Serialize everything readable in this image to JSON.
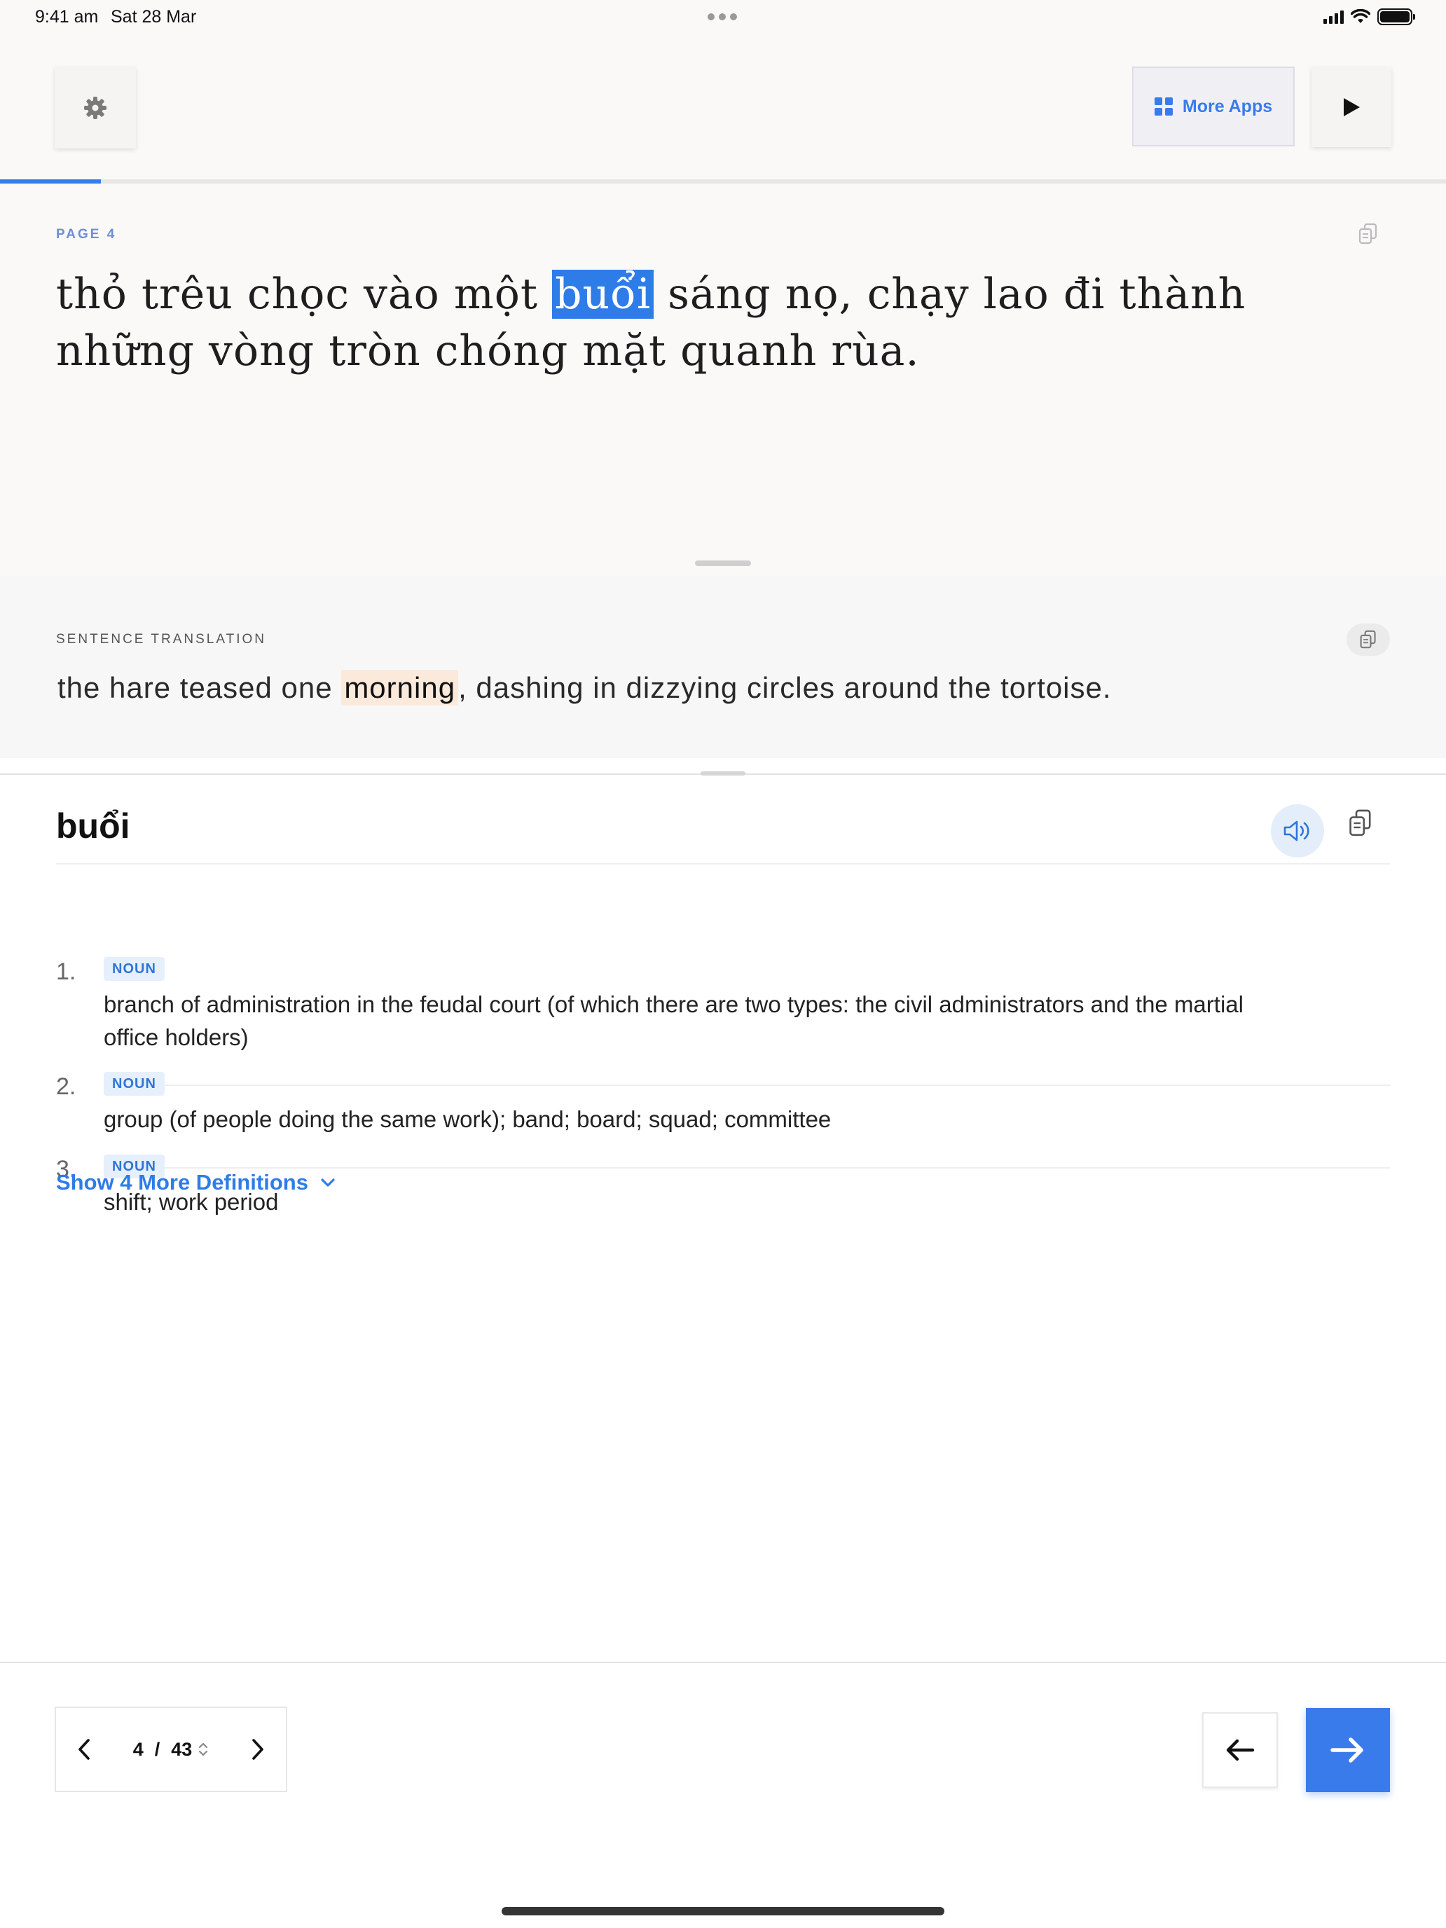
{
  "status_bar": {
    "time": "9:41 am",
    "date": "Sat 28 Mar"
  },
  "toolbar": {
    "more_apps_label": "More Apps",
    "progress_fraction": 0.07
  },
  "reader": {
    "page_label": "PAGE  4",
    "passage_before": "thỏ trêu chọc vào một ",
    "highlighted_word": "buổi",
    "passage_after": " sáng nọ, chạy lao đi thành những vòng tròn chóng mặt quanh rùa."
  },
  "translation": {
    "label": "SENTENCE TRANSLATION",
    "text_before": "the hare teased one ",
    "highlighted_word": "morning",
    "text_after": ", dashing in dizzying circles around the tortoise."
  },
  "dictionary": {
    "headword": "buổi",
    "definitions": [
      {
        "number": "1.",
        "pos": "NOUN",
        "gloss": "branch of administration in the feudal court (of which there are two types: the civil administrators and the martial office holders)"
      },
      {
        "number": "2.",
        "pos": "NOUN",
        "gloss": "group (of people doing the same work); band; board; squad; committee"
      },
      {
        "number": "3.",
        "pos": "NOUN",
        "gloss": "shift; work period"
      }
    ],
    "show_more_label": "Show 4 More Definitions"
  },
  "pager": {
    "current": "4",
    "separator": "/",
    "total": "43"
  },
  "icons": [
    "gear-icon",
    "grid-icon",
    "play-icon",
    "copy-icon",
    "speaker-icon",
    "chevron-down-icon",
    "chevron-left-icon",
    "chevron-right-icon",
    "sort-icon",
    "arrow-left-icon",
    "arrow-right-icon"
  ],
  "colors": {
    "accent": "#3a7bec",
    "word_highlight": "#2e7ce8",
    "translation_highlight": "#fbeadc"
  }
}
